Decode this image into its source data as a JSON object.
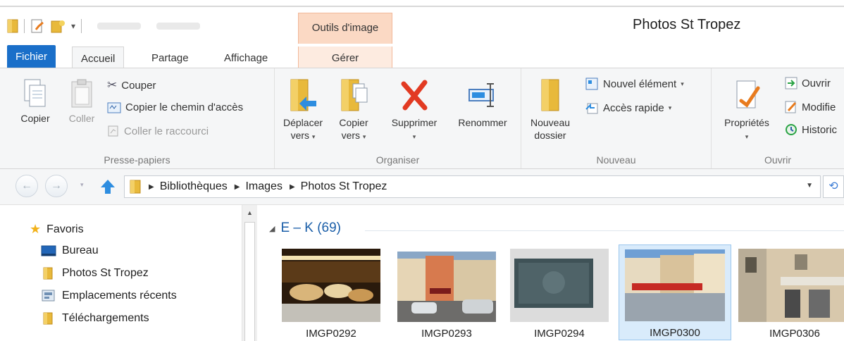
{
  "window": {
    "title": "Photos St Tropez"
  },
  "contextual_tab_group": "Outils d'image",
  "tabs": [
    {
      "label": "Fichier"
    },
    {
      "label": "Accueil"
    },
    {
      "label": "Partage"
    },
    {
      "label": "Affichage"
    },
    {
      "label": "Gérer"
    }
  ],
  "ribbon": {
    "clipboard": {
      "label": "Presse-papiers",
      "copy": "Copier",
      "paste": "Coller",
      "cut": "Couper",
      "copy_path": "Copier le chemin d'accès",
      "paste_shortcut": "Coller le raccourci"
    },
    "organize": {
      "label": "Organiser",
      "move_to": [
        "Déplacer",
        "vers"
      ],
      "copy_to": [
        "Copier",
        "vers"
      ],
      "delete": "Supprimer",
      "rename": "Renommer"
    },
    "new": {
      "label": "Nouveau",
      "new_folder": [
        "Nouveau",
        "dossier"
      ],
      "new_item": "Nouvel élément",
      "easy_access": "Accès rapide"
    },
    "open": {
      "label": "Ouvrir",
      "properties": "Propriétés",
      "open": "Ouvrir",
      "edit": "Modifie",
      "history": "Historic"
    }
  },
  "address": {
    "crumbs": [
      "Bibliothèques",
      "Images",
      "Photos St Tropez"
    ]
  },
  "nav": {
    "favorites": "Favoris",
    "items": [
      "Bureau",
      "Photos St Tropez",
      "Emplacements récents",
      "Téléchargements"
    ]
  },
  "content": {
    "group_header": "E – K (69)",
    "items": [
      {
        "name": "IMGP0292",
        "selected": false
      },
      {
        "name": "IMGP0293",
        "selected": false
      },
      {
        "name": "IMGP0294",
        "selected": false
      },
      {
        "name": "IMGP0300",
        "selected": true
      },
      {
        "name": "IMGP0306",
        "selected": false
      }
    ]
  },
  "colors": {
    "accent": "#1a6fc9",
    "context_tab": "#fbd9c4",
    "selection": "#d9ebfb"
  }
}
